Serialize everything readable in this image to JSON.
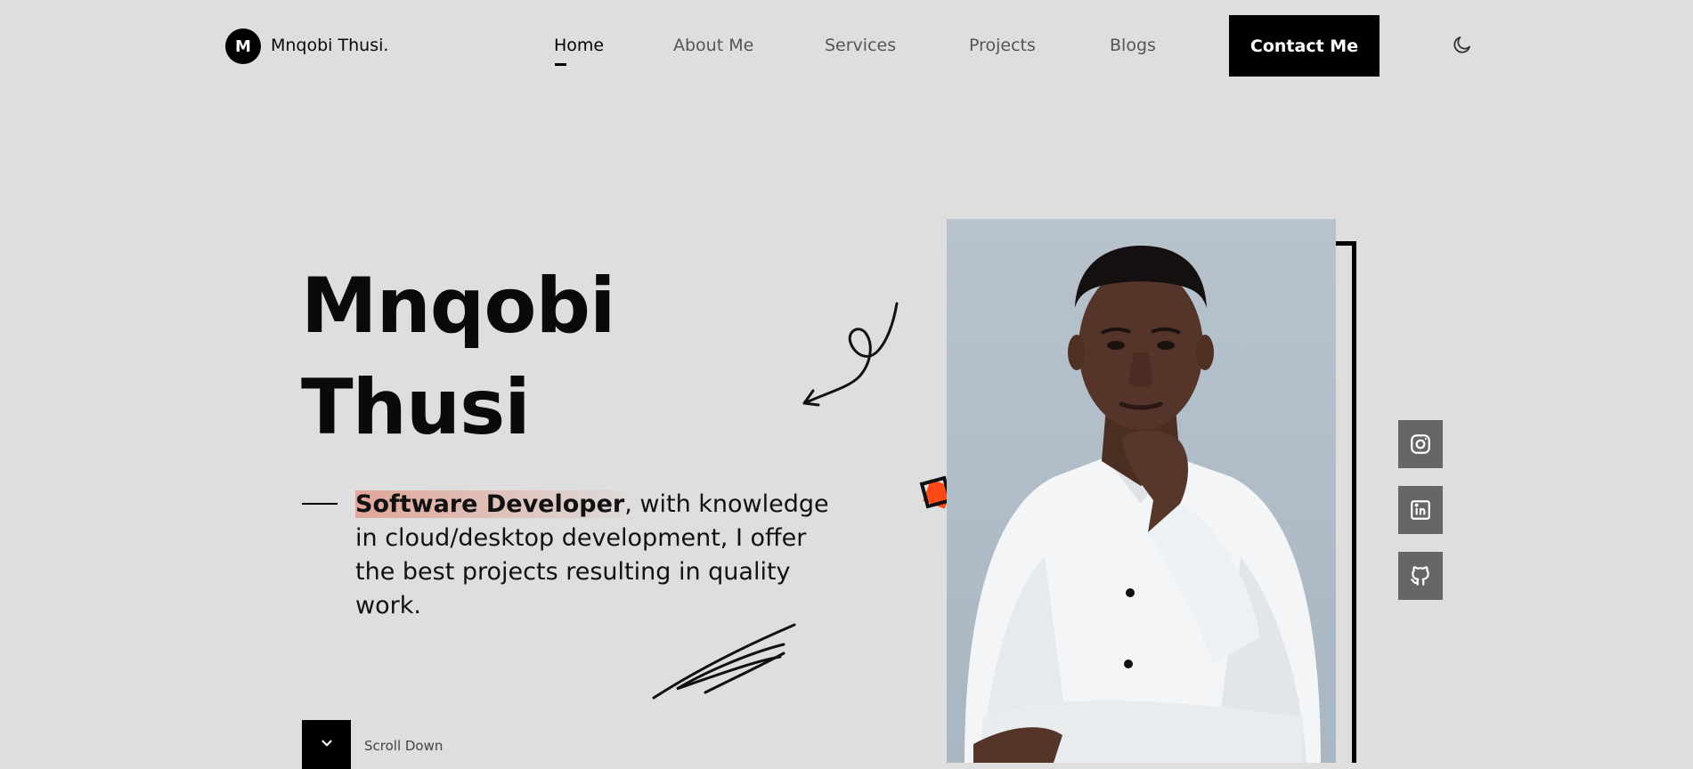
{
  "header": {
    "logo_initial": "M",
    "logo_name": "Mnqobi Thusi.",
    "nav": {
      "home": "Home",
      "about": "About Me",
      "services": "Services",
      "projects": "Projects",
      "blogs": "Blogs"
    },
    "contact_label": "Contact Me",
    "theme_toggle_icon": "moon-icon"
  },
  "hero": {
    "name_line1": "Mnqobi",
    "name_line2": "Thusi",
    "role_highlight": "Software Developer",
    "tagline_rest": ", with knowledge in cloud/desktop development, I offer the best projects resulting in quality work.",
    "scroll_label": "Scroll Down",
    "scroll_icon": "chevron-down-icon"
  },
  "socials": [
    {
      "name": "instagram",
      "icon": "instagram-icon"
    },
    {
      "name": "linkedin",
      "icon": "linkedin-icon"
    },
    {
      "name": "github",
      "icon": "github-icon"
    }
  ],
  "colors": {
    "background": "#dedede",
    "accent": "#ff4a17",
    "social_bg": "#666666",
    "highlight": "#e27860"
  }
}
